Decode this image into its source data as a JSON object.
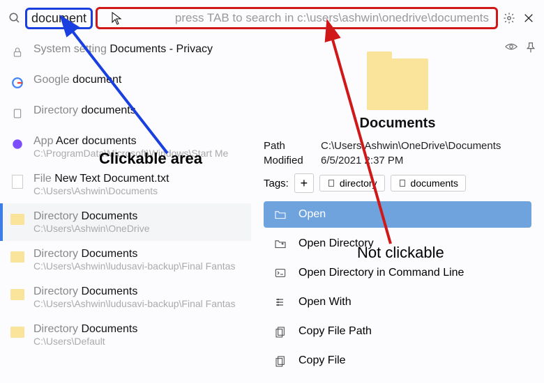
{
  "search": {
    "query": "document",
    "placeholder": "press TAB to search in c:\\users\\ashwin\\onedrive\\documents"
  },
  "results": [
    {
      "icon": "lock",
      "prefix": "System setting ",
      "strong": "Documents - Privacy",
      "sub": ""
    },
    {
      "icon": "google",
      "prefix": "Google ",
      "strong": "document",
      "sub": ""
    },
    {
      "icon": "page",
      "prefix": "Directory ",
      "strong": "documents",
      "sub": ""
    },
    {
      "icon": "app",
      "prefix": "App ",
      "strong": "Acer documents",
      "sub": "C:\\ProgramData\\Microsoft\\Windows\\Start Me"
    },
    {
      "icon": "file",
      "prefix": "File ",
      "strong": "New Text Document.txt",
      "sub": "C:\\Users\\Ashwin\\Documents"
    },
    {
      "icon": "folder",
      "prefix": "Directory ",
      "strong": "Documents",
      "sub": "C:\\Users\\Ashwin\\OneDrive",
      "selected": true
    },
    {
      "icon": "folder",
      "prefix": "Directory ",
      "strong": "Documents",
      "sub": "C:\\Users\\Ashwin\\ludusavi-backup\\Final Fantas"
    },
    {
      "icon": "folder",
      "prefix": "Directory ",
      "strong": "Documents",
      "sub": "C:\\Users\\Ashwin\\ludusavi-backup\\Final Fantas"
    },
    {
      "icon": "folder",
      "prefix": "Directory ",
      "strong": "Documents",
      "sub": "C:\\Users\\Default"
    }
  ],
  "preview": {
    "title": "Documents",
    "path_label": "Path",
    "path_value": "C:\\Users\\Ashwin\\OneDrive\\Documents",
    "modified_label": "Modified",
    "modified_value": "6/5/2021  2:37 PM",
    "tags_label": "Tags:",
    "tags": [
      "directory",
      "documents"
    ],
    "actions": [
      {
        "icon": "folder-open",
        "label": "Open",
        "primary": true
      },
      {
        "icon": "open-dir",
        "label": "Open Directory"
      },
      {
        "icon": "terminal",
        "label": "Open Directory in Command Line"
      },
      {
        "icon": "open-with",
        "label": "Open With"
      },
      {
        "icon": "copy-path",
        "label": "Copy File Path"
      },
      {
        "icon": "copy-file",
        "label": "Copy File"
      }
    ]
  },
  "annotations": {
    "clickable": "Clickable area",
    "not_clickable": "Not clickable"
  }
}
